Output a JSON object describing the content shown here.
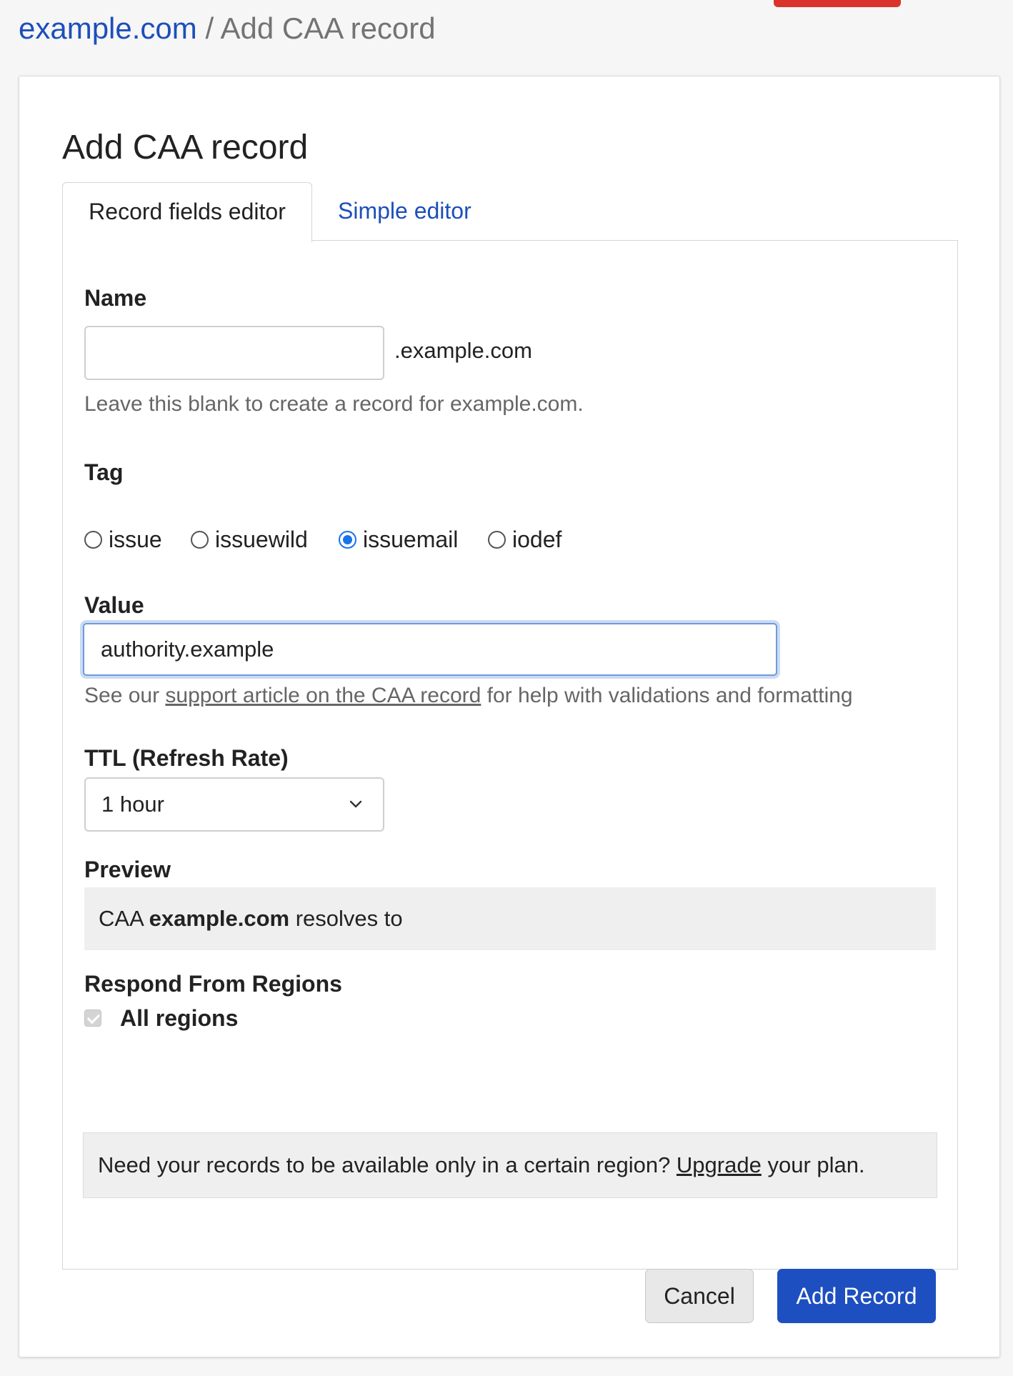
{
  "breadcrumb": {
    "domain": "example.com",
    "separator": "/",
    "current": "Add CAA record"
  },
  "form": {
    "title": "Add CAA record",
    "tabs": [
      {
        "label": "Record fields editor",
        "active": true
      },
      {
        "label": "Simple editor",
        "active": false
      }
    ],
    "name": {
      "label": "Name",
      "value": "",
      "suffix": ".example.com",
      "help": "Leave this blank to create a record for example.com."
    },
    "tag": {
      "label": "Tag",
      "options": [
        {
          "label": "issue",
          "checked": false
        },
        {
          "label": "issuewild",
          "checked": false
        },
        {
          "label": "issuemail",
          "checked": true
        },
        {
          "label": "iodef",
          "checked": false
        }
      ]
    },
    "value": {
      "label": "Value",
      "value": "authority.example",
      "help_prefix": "See our ",
      "help_link": "support article on the CAA record",
      "help_suffix": " for help with validations and formatting"
    },
    "ttl": {
      "label": "TTL (Refresh Rate)",
      "selected": "1 hour"
    },
    "preview": {
      "label": "Preview",
      "prefix": "CAA ",
      "domain": "example.com",
      "suffix": " resolves to"
    },
    "regions": {
      "label": "Respond From Regions",
      "checkbox_label": "All regions",
      "checked": true,
      "notice_prefix": "Need your records to be available only in a certain region? ",
      "notice_link": "Upgrade",
      "notice_suffix": " your plan."
    },
    "buttons": {
      "cancel": "Cancel",
      "submit": "Add Record"
    }
  },
  "colors": {
    "link": "#1d4fba",
    "primary_button": "#1d4fc0",
    "accent_red": "#d9332b",
    "radio_selected": "#1a73e8"
  },
  "icons": {
    "ttl_dropdown": "chevron-down-icon"
  }
}
